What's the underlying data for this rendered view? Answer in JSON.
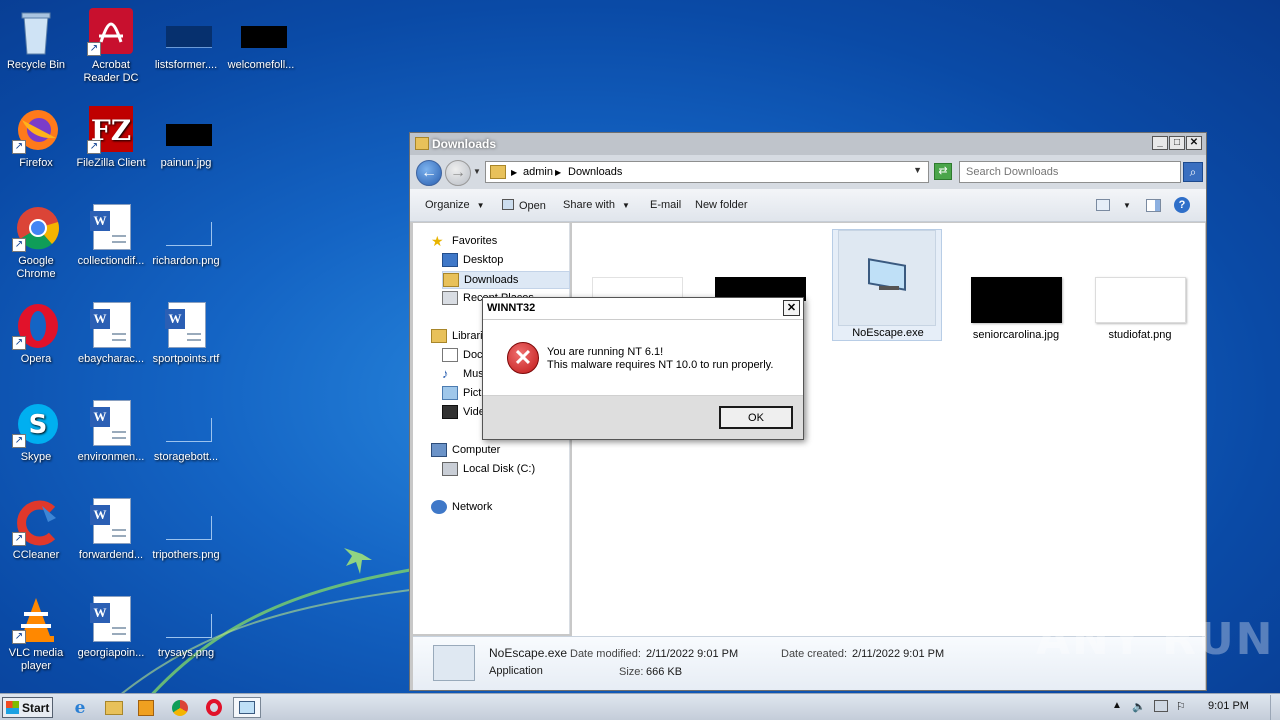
{
  "desktop": {
    "icons": [
      {
        "label": "Recycle Bin"
      },
      {
        "label": "Acrobat Reader DC"
      },
      {
        "label": "listsformer...."
      },
      {
        "label": "welcomefoll..."
      },
      {
        "label": "Firefox"
      },
      {
        "label": "FileZilla Client"
      },
      {
        "label": "painun.jpg"
      },
      {
        "label": "Google Chrome"
      },
      {
        "label": "collectiondif..."
      },
      {
        "label": "richardon.png"
      },
      {
        "label": "Opera"
      },
      {
        "label": "ebaycharac..."
      },
      {
        "label": "sportpoints.rtf"
      },
      {
        "label": "Skype"
      },
      {
        "label": "environmen..."
      },
      {
        "label": "storagebott..."
      },
      {
        "label": "CCleaner"
      },
      {
        "label": "forwardend..."
      },
      {
        "label": "tripothers.png"
      },
      {
        "label": "VLC media player"
      },
      {
        "label": "georgiapoin..."
      },
      {
        "label": "trysays.png"
      }
    ]
  },
  "explorer": {
    "title": "Downloads",
    "address": {
      "root": "admin",
      "current": "Downloads"
    },
    "search_placeholder": "Search Downloads",
    "toolbar": {
      "organize": "Organize",
      "open": "Open",
      "share_with": "Share with",
      "email": "E-mail",
      "new_folder": "New folder"
    },
    "nav": {
      "favorites": "Favorites",
      "desktop": "Desktop",
      "downloads": "Downloads",
      "recent": "Recent Places",
      "libraries": "Libraries",
      "documents": "Documents",
      "music": "Music",
      "pictures": "Pictures",
      "videos": "Videos",
      "computer": "Computer",
      "local_disk": "Local Disk (C:)",
      "network": "Network"
    },
    "files": [
      {
        "name": "NoEscape.exe"
      },
      {
        "name": "seniorcarolina.jpg"
      },
      {
        "name": "studiofat.png"
      }
    ],
    "details": {
      "name": "NoEscape.exe",
      "type": "Application",
      "modified_label": "Date modified:",
      "modified": "2/11/2022 9:01 PM",
      "size_label": "Size:",
      "size": "666 KB",
      "created_label": "Date created:",
      "created": "2/11/2022 9:01 PM"
    }
  },
  "dialog": {
    "title": "WINNT32",
    "line1": "You are running NT 6.1!",
    "line2": "This malware requires NT 10.0 to run properly.",
    "ok": "OK"
  },
  "watermark": "ANY RUN",
  "taskbar": {
    "start": "Start",
    "clock": "9:01 PM"
  }
}
